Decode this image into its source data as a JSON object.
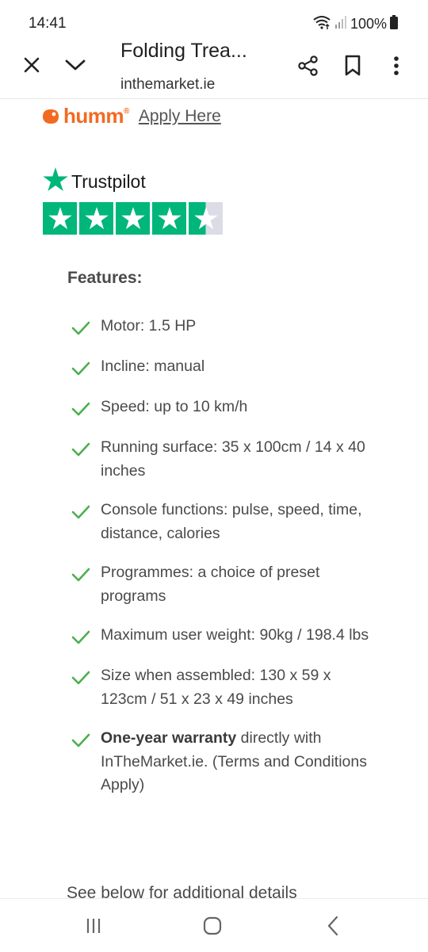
{
  "status_bar": {
    "time": "14:41",
    "battery": "100%"
  },
  "toolbar": {
    "title": "Folding Trea...",
    "domain": "inthemarket.ie",
    "icons": [
      "close-icon",
      "chevron-down-icon",
      "share-icon",
      "bookmark-icon",
      "more-vert-icon"
    ]
  },
  "humm": {
    "logo_text": "humm",
    "apply_label": "Apply Here",
    "brand_color": "#f26a21"
  },
  "trustpilot": {
    "label": "Trustpilot",
    "rating": 4.5,
    "max_rating": 5,
    "star_color": "#00b67a"
  },
  "features": {
    "heading": "Features:",
    "items": [
      {
        "bold": "",
        "text": "Motor: 1.5 HP"
      },
      {
        "bold": "",
        "text": "Incline: manual"
      },
      {
        "bold": "",
        "text": "Speed: up to 10 km/h"
      },
      {
        "bold": "",
        "text": "Running surface: 35 x 100cm / 14 x 40 inches"
      },
      {
        "bold": "",
        "text": "Console functions:  pulse, speed, time, distance, calories"
      },
      {
        "bold": "",
        "text": "Programmes: a choice of preset programs"
      },
      {
        "bold": "",
        "text": "Maximum user weight: 90kg / 198.4 lbs"
      },
      {
        "bold": "",
        "text": "Size when assembled: 130 x 59 x 123cm / 51 x 23 x 49 inches"
      },
      {
        "bold": "One-year warranty",
        "text": " directly with InTheMarket.ie. (Terms and Conditions Apply)"
      }
    ],
    "check_color": "#4caf50"
  },
  "more_details": "See below for additional details",
  "nav_bar": {
    "icons": [
      "recent-apps-icon",
      "home-icon",
      "back-icon"
    ]
  }
}
